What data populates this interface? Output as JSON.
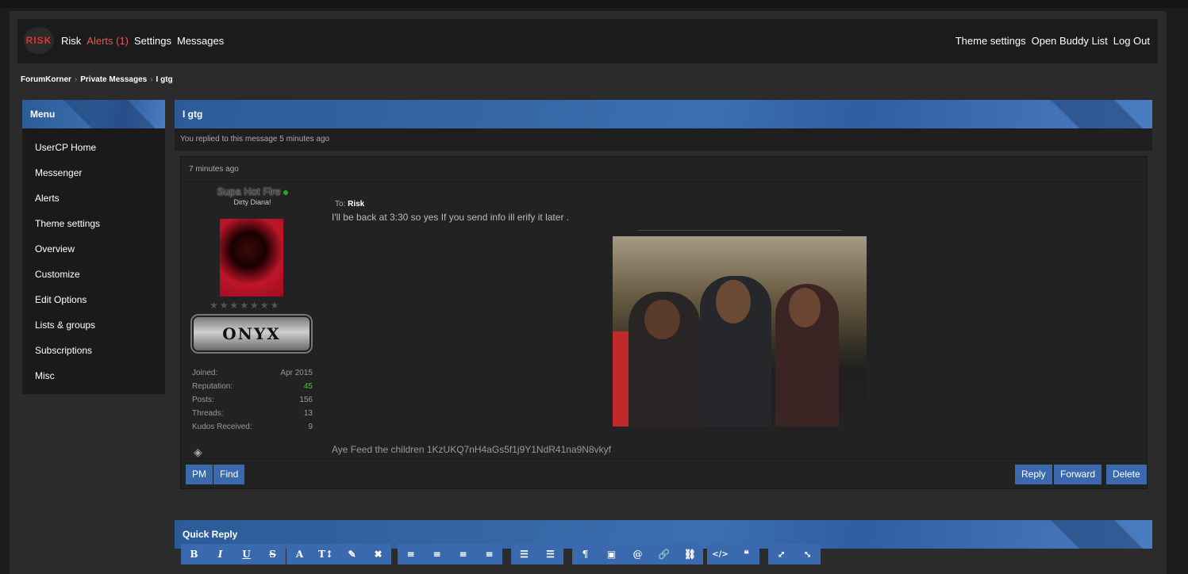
{
  "header": {
    "logo_text": "RISK",
    "nav_left": [
      "Risk",
      "Alerts (1)",
      "Settings",
      "Messages"
    ],
    "nav_right": [
      "Theme settings",
      "Open Buddy List",
      "Log Out"
    ]
  },
  "breadcrumb": [
    "ForumKorner",
    "Private Messages",
    "I gtg"
  ],
  "menu": {
    "title": "Menu",
    "items": [
      "UserCP Home",
      "Messenger",
      "Alerts",
      "Theme settings",
      "Overview",
      "Customize",
      "Edit Options",
      "Lists & groups",
      "Subscriptions",
      "Misc"
    ]
  },
  "message": {
    "title": "I gtg",
    "replied_note": "You replied to this message 5 minutes ago",
    "time": "7 minutes ago",
    "to_label": "To:",
    "to_name": "Risk",
    "body": "I'll be back at 3:30 so yes If you send info ill erify it later .",
    "body2": "Aye Feed the children 1KzUKQ7nH4aGs5f1j9Y1NdR41na9N8vkyf"
  },
  "author": {
    "name": "Supa Hot Fire",
    "title": "Dirty Diana!",
    "badge": "ONYX",
    "stars": "★★★★★★★",
    "stats": [
      {
        "label": "Joined:",
        "value": "Apr 2015"
      },
      {
        "label": "Reputation:",
        "value": "45"
      },
      {
        "label": "Posts:",
        "value": "156"
      },
      {
        "label": "Threads:",
        "value": "13"
      },
      {
        "label": "Kudos Received:",
        "value": "9"
      }
    ]
  },
  "buttons": {
    "pm": "PM",
    "find": "Find",
    "reply": "Reply",
    "forward": "Forward",
    "delete": "Delete"
  },
  "quick_reply": {
    "title": "Quick Reply",
    "toolbar": [
      [
        "B",
        "I",
        "U",
        "S"
      ],
      [
        "A",
        "T↕",
        "✎",
        "✖"
      ],
      [
        "≡",
        "≡",
        "≡",
        "≡"
      ],
      [
        "☰",
        "☰"
      ],
      [
        "¶",
        "▣",
        "@",
        "🔗",
        "⛓"
      ],
      [
        "</>",
        "❝"
      ],
      [
        "⤢",
        "⤡"
      ]
    ]
  },
  "colors": {
    "accent": "#3a6aad",
    "alert": "#e45b4a",
    "reputation": "#33cc33"
  }
}
